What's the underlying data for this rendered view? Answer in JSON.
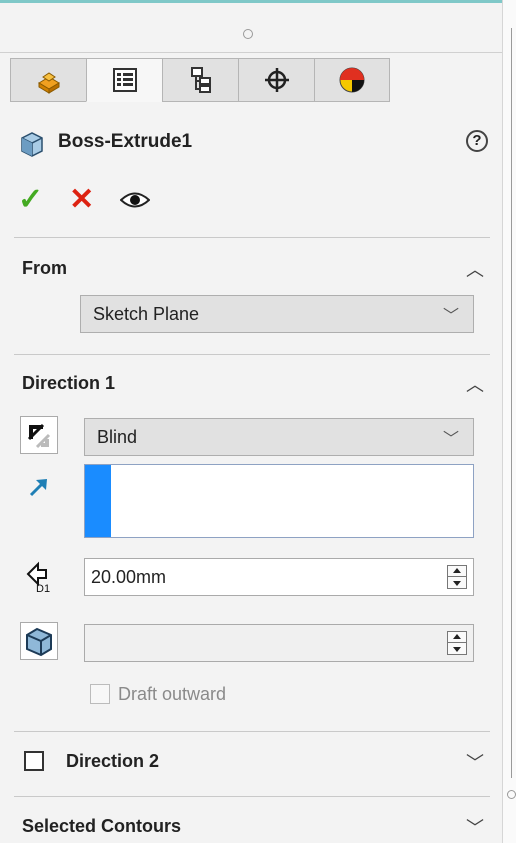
{
  "feature": {
    "title": "Boss-Extrude1"
  },
  "tabs": [
    {
      "icon": "feature-manager-icon"
    },
    {
      "icon": "property-manager-icon",
      "active": true
    },
    {
      "icon": "configuration-manager-icon"
    },
    {
      "icon": "dimxpert-manager-icon"
    },
    {
      "icon": "display-manager-icon"
    }
  ],
  "from": {
    "label": "From",
    "value": "Sketch Plane"
  },
  "direction1": {
    "label": "Direction 1",
    "end_condition": "Blind",
    "depth": "20.00mm",
    "draft_label": "Draft outward"
  },
  "direction2": {
    "label": "Direction 2"
  },
  "selected_contours": {
    "label": "Selected Contours"
  },
  "colors": {
    "accent": "#1a8cff",
    "ok": "#44aa22",
    "cancel": "#dd2211"
  }
}
